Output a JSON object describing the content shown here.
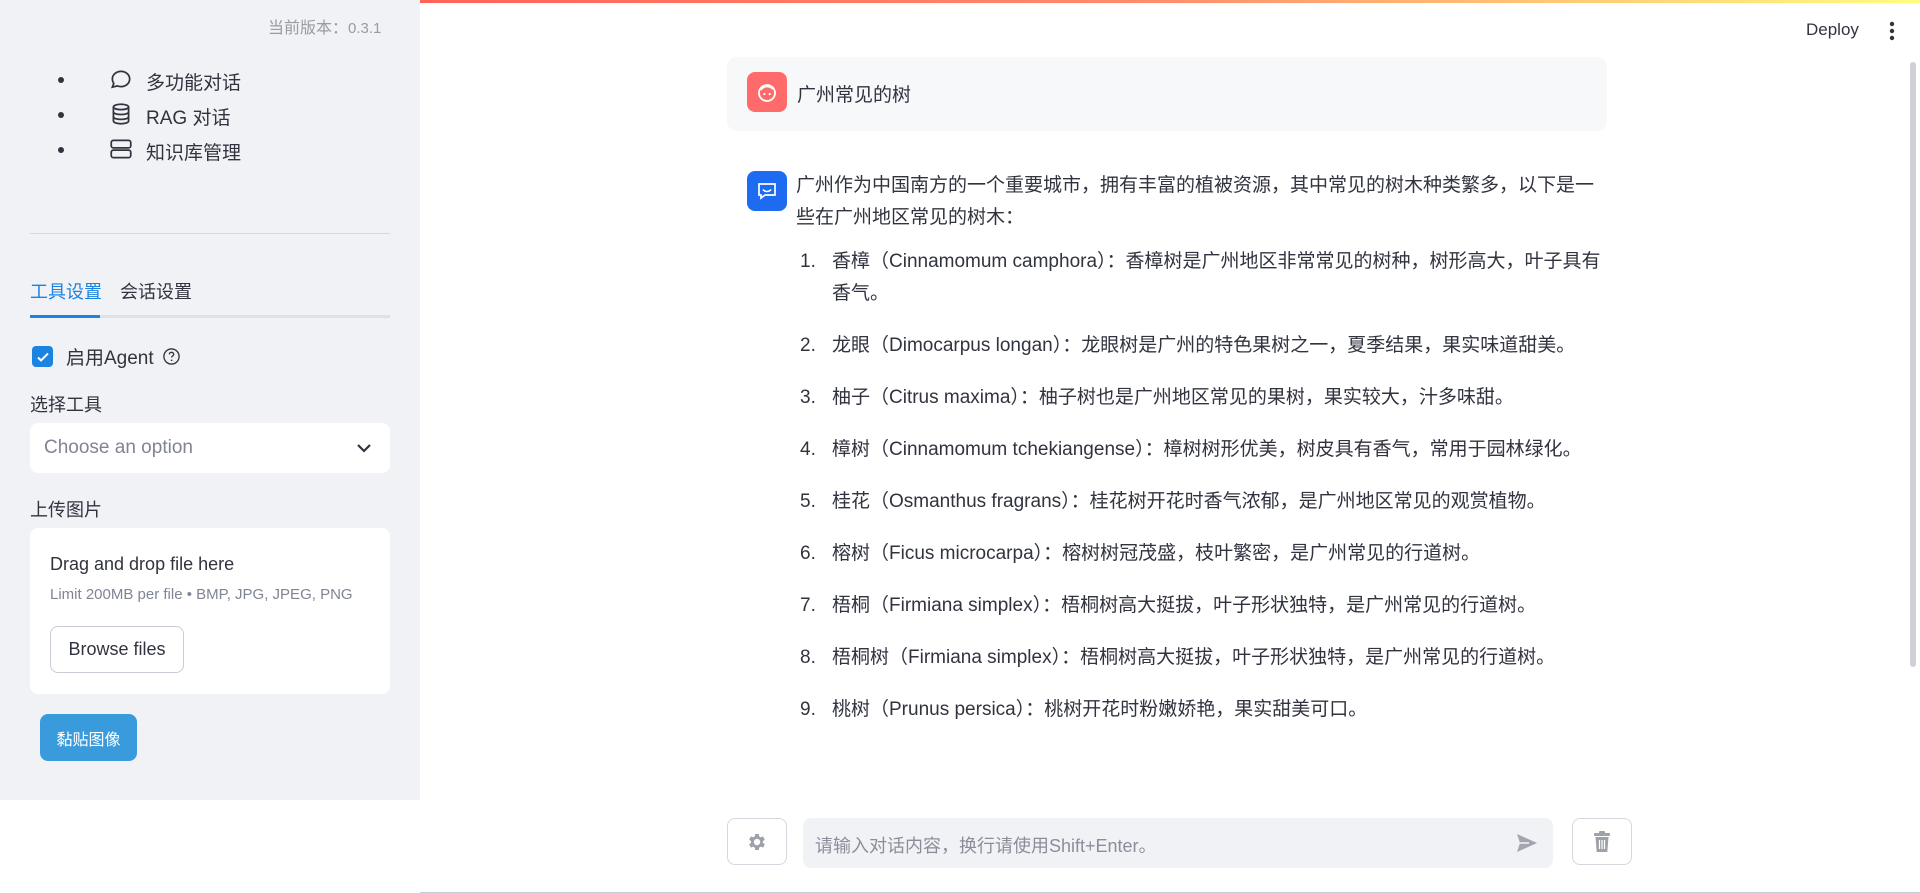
{
  "sidebar": {
    "version_label": "当前版本：",
    "version_number": "0.3.1",
    "nav_items": [
      {
        "label": "多功能对话",
        "icon": "chat-bubble-icon"
      },
      {
        "label": "RAG 对话",
        "icon": "database-icon"
      },
      {
        "label": "知识库管理",
        "icon": "server-icon"
      }
    ],
    "tabs": [
      {
        "label": "工具设置",
        "active": true
      },
      {
        "label": "会话设置",
        "active": false
      }
    ],
    "agent_checkbox": {
      "label": "启用Agent",
      "checked": true
    },
    "tool_select": {
      "label": "选择工具",
      "placeholder": "Choose an option"
    },
    "upload": {
      "label": "上传图片",
      "drop_title": "Drag and drop file here",
      "limit": "Limit 200MB per file • BMP, JPG, JPEG, PNG",
      "browse_label": "Browse files"
    },
    "paste_button": "黏贴图像"
  },
  "header": {
    "deploy_label": "Deploy"
  },
  "chat": {
    "user_message": "广州常见的树",
    "bot_intro": "广州作为中国南方的一个重要城市，拥有丰富的植被资源，其中常见的树木种类繁多，以下是一些在广州地区常见的树木：",
    "bot_items": [
      {
        "num": "1.",
        "text": "香樟（Cinnamomum camphora）：香樟树是广州地区非常常见的树种，树形高大，叶子具有香气。"
      },
      {
        "num": "2.",
        "text": "龙眼（Dimocarpus longan）：龙眼树是广州的特色果树之一，夏季结果，果实味道甜美。"
      },
      {
        "num": "3.",
        "text": "柚子（Citrus maxima）：柚子树也是广州地区常见的果树，果实较大，汁多味甜。"
      },
      {
        "num": "4.",
        "text": "樟树（Cinnamomum tchekiangense）：樟树树形优美，树皮具有香气，常用于园林绿化。"
      },
      {
        "num": "5.",
        "text": "桂花（Osmanthus fragrans）：桂花树开花时香气浓郁，是广州地区常见的观赏植物。"
      },
      {
        "num": "6.",
        "text": "榕树（Ficus microcarpa）：榕树树冠茂盛，枝叶繁密，是广州常见的行道树。"
      },
      {
        "num": "7.",
        "text": "梧桐（Firmiana simplex）：梧桐树高大挺拔，叶子形状独特，是广州常见的行道树。"
      },
      {
        "num": "8.",
        "text": "梧桐树（Firmiana simplex）：梧桐树高大挺拔，叶子形状独特，是广州常见的行道树。"
      },
      {
        "num": "9.",
        "text": "桃树（Prunus persica）：桃树开花时粉嫩娇艳，果实甜美可口。"
      }
    ]
  },
  "input": {
    "placeholder": "请输入对话内容，换行请使用Shift+Enter。"
  },
  "colors": {
    "accent": "#1c83e1",
    "sidebar_bg": "#f0f2f6",
    "user_avatar": "#ff6b6b",
    "bot_avatar": "#1d6bf0",
    "paste_button": "#3a9bdc"
  }
}
